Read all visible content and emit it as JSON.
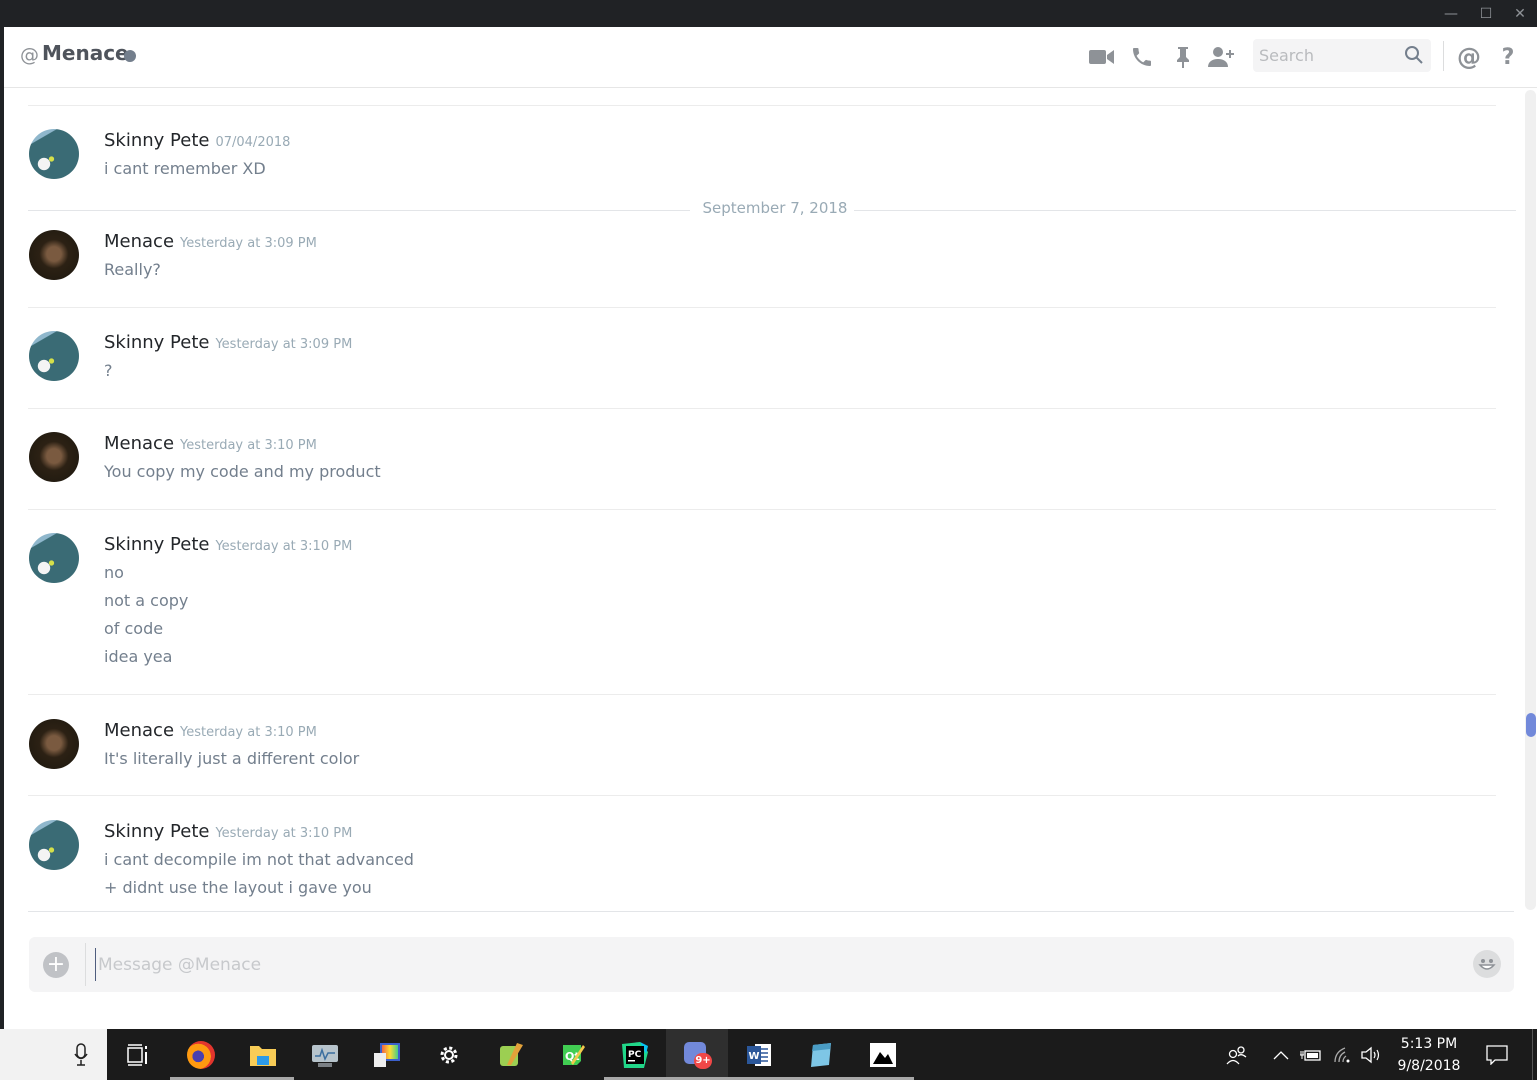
{
  "window": {
    "minimize": "—",
    "maximize": "☐",
    "close": "✕"
  },
  "header": {
    "at_symbol": "@",
    "title": "Menace",
    "status": "offline",
    "status_color": "#747f8d",
    "icons": [
      "video-call-icon",
      "voice-call-icon",
      "pin-icon",
      "add-friend-icon"
    ],
    "search_placeholder": "Search",
    "mentions_label": "@",
    "help_label": "?"
  },
  "messages": [
    {
      "author": "Skinny Pete",
      "timestamp": "07/04/2018",
      "avatar": "tom-cat",
      "lines": [
        "i cant remember XD"
      ]
    },
    {
      "author": "Menace",
      "timestamp": "Yesterday at 3:09 PM",
      "avatar": "man",
      "lines": [
        "Really?"
      ]
    },
    {
      "author": "Skinny Pete",
      "timestamp": "Yesterday at 3:09 PM",
      "avatar": "tom-cat",
      "lines": [
        "?"
      ]
    },
    {
      "author": "Menace",
      "timestamp": "Yesterday at 3:10 PM",
      "avatar": "man",
      "lines": [
        "You copy my code and my product"
      ]
    },
    {
      "author": "Skinny Pete",
      "timestamp": "Yesterday at 3:10 PM",
      "avatar": "tom-cat",
      "lines": [
        "no",
        "not a copy",
        "of code",
        "idea yea"
      ]
    },
    {
      "author": "Menace",
      "timestamp": "Yesterday at 3:10 PM",
      "avatar": "man",
      "lines": [
        "It's literally just a different color"
      ]
    },
    {
      "author": "Skinny Pete",
      "timestamp": "Yesterday at 3:10 PM",
      "avatar": "tom-cat",
      "lines": [
        "i cant decompile im not that advanced",
        "+ didnt use the layout i gave you"
      ]
    }
  ],
  "date_divider": "September 7, 2018",
  "composer": {
    "placeholder": "Message @Menace",
    "value": ""
  },
  "taskbar": {
    "apps": [
      "task-view",
      "firefox",
      "file-explorer",
      "resource-monitor",
      "control-panel",
      "settings",
      "notepad-plus-plus",
      "qt-creator",
      "pycharm",
      "discord",
      "word",
      "notepad",
      "photos"
    ],
    "discord_badge": "9+",
    "time": "5:13 PM",
    "date": "9/8/2018"
  },
  "colors": {
    "accent": "#7289da",
    "badge": "#f04747"
  }
}
